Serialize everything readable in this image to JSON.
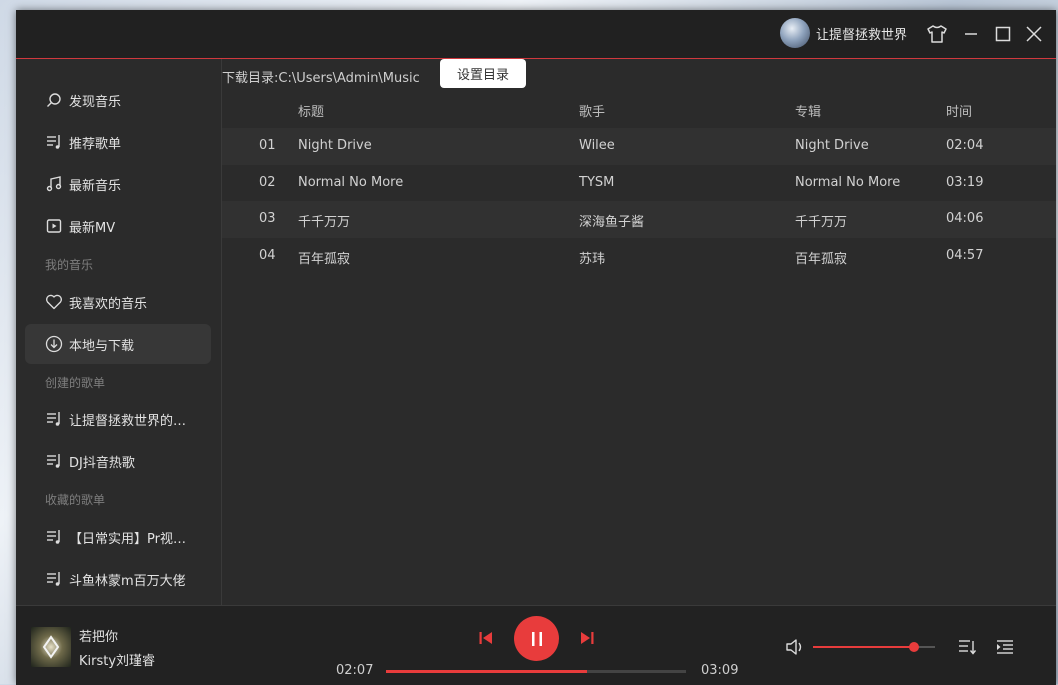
{
  "titlebar": {
    "username": "让提督拯救世界"
  },
  "sidebar": {
    "items": [
      {
        "label": "发现音乐",
        "icon": "search-icon"
      },
      {
        "label": "推荐歌单",
        "icon": "playlist-icon"
      },
      {
        "label": "最新音乐",
        "icon": "music-note-icon"
      },
      {
        "label": "最新MV",
        "icon": "video-icon"
      }
    ],
    "section_my": "我的音乐",
    "my_items": [
      {
        "label": "我喜欢的音乐",
        "icon": "heart-icon"
      },
      {
        "label": "本地与下载",
        "icon": "download-icon"
      }
    ],
    "section_created": "创建的歌单",
    "created_items": [
      {
        "label": "让提督拯救世界的喜欢的音乐",
        "icon": "playlist-icon"
      },
      {
        "label": "DJ抖音热歌",
        "icon": "playlist-icon"
      }
    ],
    "section_collected": "收藏的歌单",
    "collected_items": [
      {
        "label": "【日常实用】Pr视频剪辑必备",
        "icon": "playlist-icon"
      },
      {
        "label": "斗鱼林蒙m百万大佬",
        "icon": "playlist-icon"
      }
    ]
  },
  "main": {
    "download_dir_label": "下载目录:C:\\Users\\Admin\\Music",
    "set_dir_button": "设置目录",
    "columns": {
      "title": "标题",
      "artist": "歌手",
      "album": "专辑",
      "time": "时间"
    },
    "rows": [
      {
        "idx": "01",
        "title": "Night Drive",
        "artist": "Wilee",
        "album": "Night Drive",
        "time": "02:04"
      },
      {
        "idx": "02",
        "title": "Normal No More",
        "artist": "TYSM",
        "album": "Normal No More",
        "time": "03:19"
      },
      {
        "idx": "03",
        "title": "千千万万",
        "artist": "深海鱼子酱",
        "album": "千千万万",
        "time": "04:06"
      },
      {
        "idx": "04",
        "title": "百年孤寂",
        "artist": "苏玮",
        "album": "百年孤寂",
        "time": "04:57"
      }
    ]
  },
  "player": {
    "song_title": "若把你",
    "song_artist": "Kirsty刘瑾睿",
    "current_time": "02:07",
    "total_time": "03:09",
    "progress_fraction": 0.67,
    "volume_fraction": 0.83
  },
  "colors": {
    "accent": "#e83c3c"
  }
}
